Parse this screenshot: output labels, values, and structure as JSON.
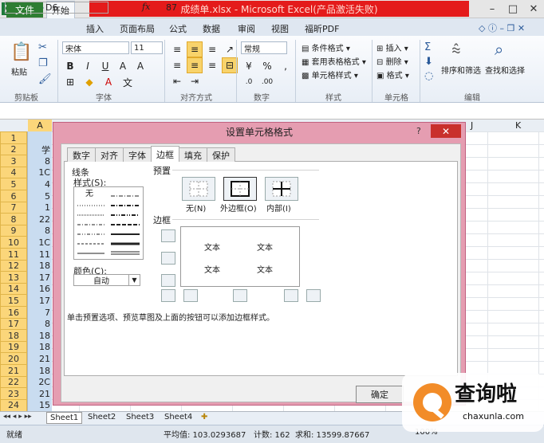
{
  "window": {
    "title": "成绩单.xlsx - Microsoft Excel(产品激活失败)"
  },
  "ribbon": {
    "file_tab": "文件",
    "tabs": [
      "开始",
      "插入",
      "页面布局",
      "公式",
      "数据",
      "审阅",
      "视图",
      "福昕PDF"
    ],
    "paste_label": "粘贴",
    "font_name": "宋体",
    "font_size": "11",
    "number_format": "常规",
    "cond_format": "条件格式",
    "table_format": "套用表格格式",
    "cell_style": "单元格样式",
    "insert": "插入",
    "delete": "删除",
    "format": "格式",
    "sort_filter": "排序和筛选",
    "find_select": "查找和选择",
    "groups": [
      "剪贴板",
      "字体",
      "对齐方式",
      "数字",
      "样式",
      "单元格",
      "编辑"
    ]
  },
  "formula_bar": {
    "cell_ref": "D6",
    "fx": "fx",
    "value": "87"
  },
  "grid": {
    "col_headers": [
      "A",
      "J",
      "K"
    ],
    "rows": [
      "1",
      "2",
      "3",
      "4",
      "5",
      "6",
      "7",
      "8",
      "9",
      "10",
      "11",
      "12",
      "13",
      "14",
      "15",
      "16",
      "17",
      "18",
      "19",
      "20",
      "21",
      "22",
      "23",
      "24"
    ],
    "colA": [
      "",
      "学",
      "8",
      "1C",
      "4",
      "5",
      "1",
      "22",
      "8",
      "1C",
      "11",
      "18",
      "17",
      "16",
      "17",
      "7",
      "8",
      "18",
      "18",
      "21",
      "18",
      "2C",
      "21",
      "15"
    ]
  },
  "sheets": [
    "Sheet1",
    "Sheet2",
    "Sheet3",
    "Sheet4"
  ],
  "status": {
    "ready": "就绪",
    "average": "平均值: 103.0293687",
    "count": "计数: 162",
    "sum": "求和: 13599.87667",
    "zoom": "100%"
  },
  "dialog": {
    "title": "设置单元格格式",
    "tabs": [
      "数字",
      "对齐",
      "字体",
      "边框",
      "填充",
      "保护"
    ],
    "active_tab": "边框",
    "line_section": "线条",
    "style_label": "样式(S):",
    "none_label": "无",
    "color_label": "颜色(C):",
    "color_value": "自动",
    "preset_section": "预置",
    "preset_none": "无(N)",
    "preset_outline": "外边框(O)",
    "preset_inside": "内部(I)",
    "border_section": "边框",
    "preview_text": "文本",
    "hint": "单击预置选项、预览草图及上面的按钮可以添加边框样式。",
    "ok": "确定"
  },
  "watermark": {
    "brand": "查询啦",
    "url": "chaxunla.com"
  }
}
